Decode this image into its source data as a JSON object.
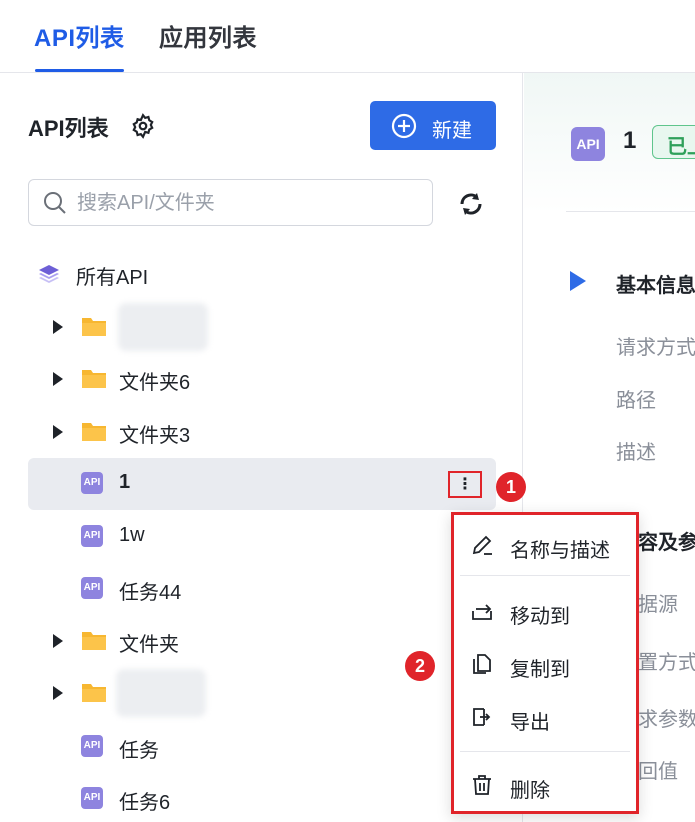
{
  "tabs": [
    {
      "label": "API列表",
      "active": true
    },
    {
      "label": "应用列表",
      "active": false
    }
  ],
  "sidebar": {
    "title": "API列表",
    "new_button": "新建",
    "search_placeholder": "搜索API/文件夹",
    "all_apis": "所有API",
    "items": [
      {
        "type": "folder",
        "label": "",
        "blurred": true
      },
      {
        "type": "folder",
        "label": "文件夹6"
      },
      {
        "type": "folder",
        "label": "文件夹3"
      },
      {
        "type": "api",
        "label": "1",
        "selected": true
      },
      {
        "type": "api",
        "label": "1w"
      },
      {
        "type": "api",
        "label": "任务44"
      },
      {
        "type": "folder",
        "label": "文件夹"
      },
      {
        "type": "folder",
        "label": "",
        "blurred": true
      },
      {
        "type": "api",
        "label": "任务"
      },
      {
        "type": "api",
        "label": "任务6"
      }
    ],
    "api_icon_text": "API",
    "more_button": "⋮"
  },
  "context_menu": {
    "items": [
      {
        "label": "名称与描述",
        "icon": "edit-icon"
      },
      {
        "label": "移动到",
        "icon": "move-icon"
      },
      {
        "label": "复制到",
        "icon": "copy-icon"
      },
      {
        "label": "导出",
        "icon": "export-icon"
      },
      {
        "label": "删除",
        "icon": "delete-icon"
      }
    ]
  },
  "annotations": {
    "step1": "1",
    "step2": "2"
  },
  "detail": {
    "api_icon_text": "API",
    "name": "1",
    "status": "已上",
    "section_basic": "基本信息",
    "fields_basic": [
      "请求方式",
      "路径",
      "描述"
    ],
    "section_content": "容及参",
    "fields_content": [
      "据源",
      "置方式",
      "求参数",
      "回值"
    ]
  },
  "colors": {
    "primary": "#2e6be6",
    "accent_tab": "#1f5ce6",
    "annotation_red": "#e0242a",
    "api_icon": "#8e84df",
    "folder": "#f7b731"
  }
}
